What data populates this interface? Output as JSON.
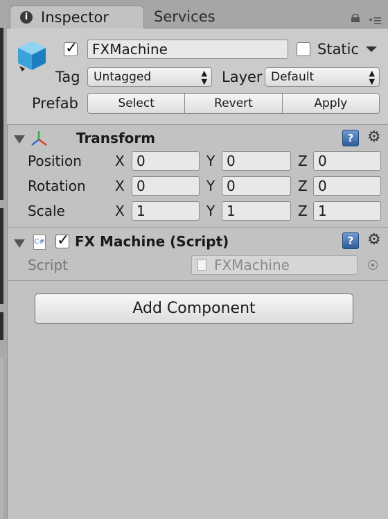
{
  "tabs": {
    "inspector": "Inspector",
    "services": "Services"
  },
  "game_object": {
    "name": "FXMachine",
    "active": true,
    "static_label": "Static",
    "static_checked": false,
    "tag_label": "Tag",
    "tag_value": "Untagged",
    "layer_label": "Layer",
    "layer_value": "Default",
    "prefab_label": "Prefab",
    "prefab_buttons": [
      "Select",
      "Revert",
      "Apply"
    ]
  },
  "transform": {
    "title": "Transform",
    "axis_labels": [
      "X",
      "Y",
      "Z"
    ],
    "rows": [
      {
        "label": "Position",
        "values": [
          "0",
          "0",
          "0"
        ]
      },
      {
        "label": "Rotation",
        "values": [
          "0",
          "0",
          "0"
        ]
      },
      {
        "label": "Scale",
        "values": [
          "1",
          "1",
          "1"
        ]
      }
    ]
  },
  "script_component": {
    "title": "FX Machine (Script)",
    "enabled": true,
    "script_label": "Script",
    "script_value": "FXMachine",
    "icon_text": "C#"
  },
  "add_component_label": "Add Component",
  "icons": {
    "info": "info-icon",
    "lock": "lock-icon",
    "menu": "tab-menu-icon",
    "cube": "game-object-cube-icon",
    "help": "help-icon",
    "gear": "gear-icon",
    "transform": "transform-axes-icon",
    "script": "csharp-script-icon",
    "target": "object-picker-icon"
  },
  "colors": {
    "panel_bg": "#c2c2c2",
    "tab_bar_bg": "#a6a6a6",
    "help_blue": "#2f5d9a"
  }
}
